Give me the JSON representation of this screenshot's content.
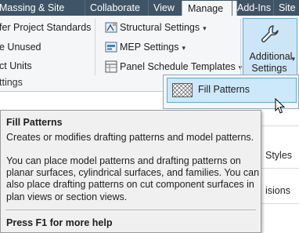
{
  "tabs": [
    "Massing & Site",
    "Collaborate",
    "View",
    "Manage",
    "Add-Ins",
    "Site"
  ],
  "active_tab": "Manage",
  "ribbon": {
    "settings_panel": {
      "items": [
        "fer Project Standards",
        "e Unused",
        "ct Units"
      ],
      "panel_label": "ttings"
    },
    "middle": {
      "structural": "Structural Settings",
      "mep": "MEP Settings",
      "panel_schedule": "Panel Schedule Templates"
    },
    "additional_settings": {
      "label_line1": "Additional",
      "label_line2": "Settings",
      "icon": "wrench-icon"
    }
  },
  "dropdown": {
    "items": [
      {
        "label": "Fill Patterns",
        "icon": "fill-pattern-icon"
      }
    ]
  },
  "background_partial": {
    "styles": "Styles",
    "visions": "isions"
  },
  "tooltip": {
    "title": "Fill Patterns",
    "description": "Creates or modifies drafting patterns and model patterns.",
    "body": "You can place model patterns and drafting patterns on planar surfaces, cylindrical surfaces, and families. You can also place drafting patterns on cut component surfaces in plan views or section views.",
    "help": "Press F1 for more help"
  },
  "colors": {
    "tab_bar": "#3f5466",
    "ribbon_bg": "#f4f6f8",
    "highlight": "#cde6f7",
    "tooltip_bg": "#f0f0f0"
  }
}
